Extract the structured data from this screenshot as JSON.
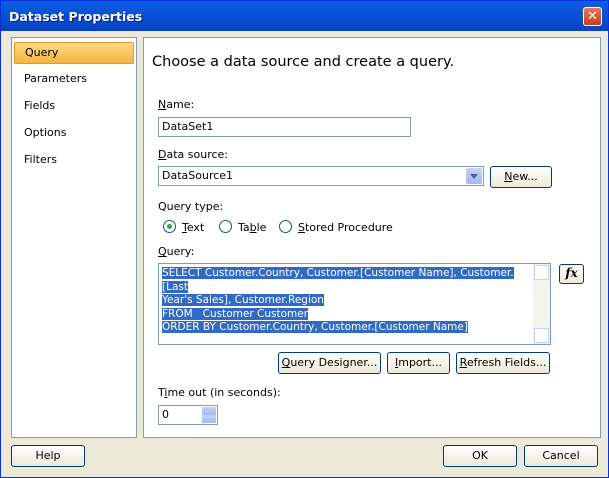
{
  "window": {
    "title": "Dataset Properties",
    "close_glyph": "✕"
  },
  "nav": {
    "items": [
      {
        "label": "Query",
        "selected": true
      },
      {
        "label": "Parameters",
        "selected": false
      },
      {
        "label": "Fields",
        "selected": false
      },
      {
        "label": "Options",
        "selected": false
      },
      {
        "label": "Filters",
        "selected": false
      }
    ]
  },
  "page": {
    "heading": "Choose a data source and create a query.",
    "name_label_u": "N",
    "name_label_rest": "ame:",
    "name_value": "DataSet1",
    "datasource_label_u": "D",
    "datasource_label_rest": "ata source:",
    "datasource_value": "DataSource1",
    "new_button_u": "N",
    "new_button_rest": "ew...",
    "querytype_label": "Query type:",
    "radio_text_u": "T",
    "radio_text_rest": "ext",
    "radio_table_pre": "Ta",
    "radio_table_u": "b",
    "radio_table_rest": "le",
    "radio_stored_u": "S",
    "radio_stored_rest": "tored Procedure",
    "selected_query_type": "Text",
    "query_label_u": "Q",
    "query_label_rest": "uery:",
    "query_lines": [
      "SELECT Customer.Country, Customer.[Customer Name], Customer.[Last",
      "Year's Sales], Customer.Region",
      "FROM   Customer Customer",
      "ORDER BY Customer.Country, Customer.[Customer Name]"
    ],
    "fx_label": "fx",
    "query_designer_u": "Q",
    "query_designer_rest": "uery Designer...",
    "import_u": "I",
    "import_rest": "mport...",
    "refresh_u": "R",
    "refresh_rest": "efresh Fields...",
    "timeout_pre": "T",
    "timeout_u": "i",
    "timeout_rest": "me out (in seconds):",
    "timeout_value": "0"
  },
  "footer": {
    "help": "Help",
    "ok": "OK",
    "cancel": "Cancel"
  }
}
